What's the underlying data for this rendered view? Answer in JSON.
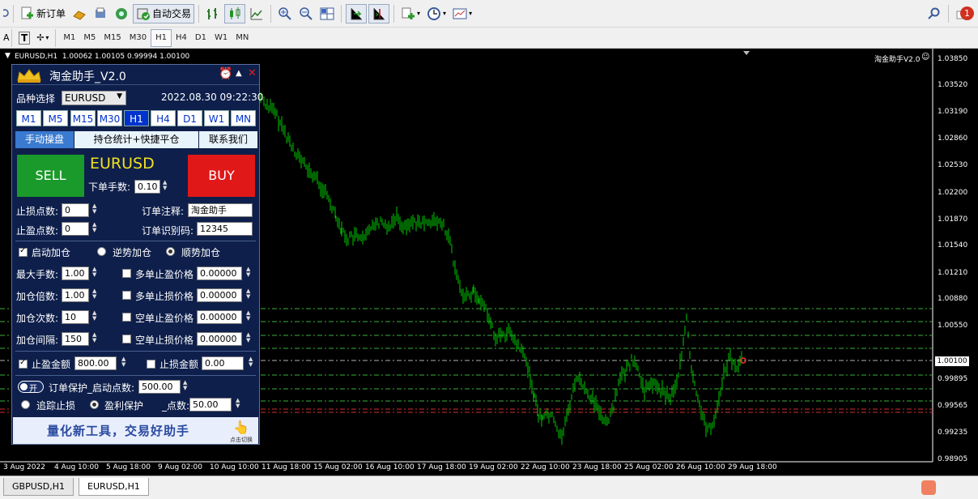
{
  "toolbar": {
    "new_order_label": "新订单",
    "auto_trade_label": "自动交易",
    "notification_count": "1"
  },
  "timeframes_toolbar": [
    "M1",
    "M5",
    "M15",
    "M30",
    "H1",
    "H4",
    "D1",
    "W1",
    "MN"
  ],
  "timeframes_toolbar_active": "H1",
  "chart": {
    "header": "EURUSD,H1  1.00062 1.00105 0.99994 1.00100",
    "ea_name": "淘金助手V2.0",
    "current_price": "1.00100",
    "line_color": "#00c800",
    "background_color": "#000000",
    "y_labels": [
      "1.03850",
      "1.03520",
      "1.03190",
      "1.02860",
      "1.02530",
      "1.02200",
      "1.01870",
      "1.01540",
      "1.01210",
      "1.00880",
      "1.00550",
      "1.00100",
      "0.99895",
      "0.99565",
      "0.99235",
      "0.98905"
    ],
    "x_labels": [
      "3 Aug 2022",
      "4 Aug 10:00",
      "5 Aug 18:00",
      "9 Aug 02:00",
      "10 Aug 10:00",
      "11 Aug 18:00",
      "15 Aug 02:00",
      "16 Aug 10:00",
      "17 Aug 18:00",
      "19 Aug 02:00",
      "22 Aug 10:00",
      "23 Aug 18:00",
      "25 Aug 02:00",
      "26 Aug 10:00",
      "29 Aug 18:00"
    ]
  },
  "panel": {
    "title": "淘金助手_V2.0",
    "symbol_label": "品种选择",
    "symbol_value": "EURUSD",
    "datetime": "2022.08.30 09:22:30",
    "timeframes": [
      "M1",
      "M5",
      "M15",
      "M30",
      "H1",
      "H4",
      "D1",
      "W1",
      "MN"
    ],
    "active_timeframe": "H1",
    "tabs": [
      "手动操盘",
      "持仓统计+快捷平仓",
      "联系我们"
    ],
    "active_tab": "手动操盘",
    "sell_label": "SELL",
    "buy_label": "BUY",
    "symbol_display": "EURUSD",
    "lot_label": "下单手数:",
    "lot_value": "0.10",
    "sl_points_label": "止损点数:",
    "sl_points_value": "0",
    "tp_points_label": "止盈点数:",
    "tp_points_value": "0",
    "order_comment_label": "订单注释:",
    "order_comment_value": "淘金助手",
    "magic_label": "订单识别码:",
    "magic_value": "12345",
    "enable_add_label": "启动加仓",
    "counter_add_label": "逆势加仓",
    "trend_add_label": "顺势加仓",
    "max_lot_label": "最大手数:",
    "max_lot_value": "1.00",
    "add_multiplier_label": "加仓倍数:",
    "add_multiplier_value": "1.00",
    "add_count_label": "加仓次数:",
    "add_count_value": "10",
    "add_interval_label": "加仓间隔:",
    "add_interval_value": "150",
    "buy_tp_price_label": "多单止盈价格",
    "buy_tp_price_value": "0.00000",
    "buy_sl_price_label": "多单止损价格",
    "buy_sl_price_value": "0.00000",
    "sell_tp_price_label": "空单止盈价格",
    "sell_tp_price_value": "0.00000",
    "sell_sl_price_label": "空单止损价格",
    "sell_sl_price_value": "0.00000",
    "tp_amount_label": "止盈金额",
    "tp_amount_value": "800.00",
    "sl_amount_label": "止损金额",
    "sl_amount_value": "0.00",
    "toggle_label": "开",
    "order_protect_label": "订单保护_启动点数:",
    "order_protect_value": "500.00",
    "trailing_stop_label": "追踪止损",
    "profit_protect_label": "盈利保护",
    "points_label": "_点数:",
    "points_value": "50.00",
    "banner_text": "量化新工具，交易好助手",
    "banner_sub": "点击切换"
  },
  "bottom_tabs": [
    "GBPUSD,H1",
    "EURUSD,H1"
  ],
  "active_bottom_tab": "EURUSD,H1"
}
